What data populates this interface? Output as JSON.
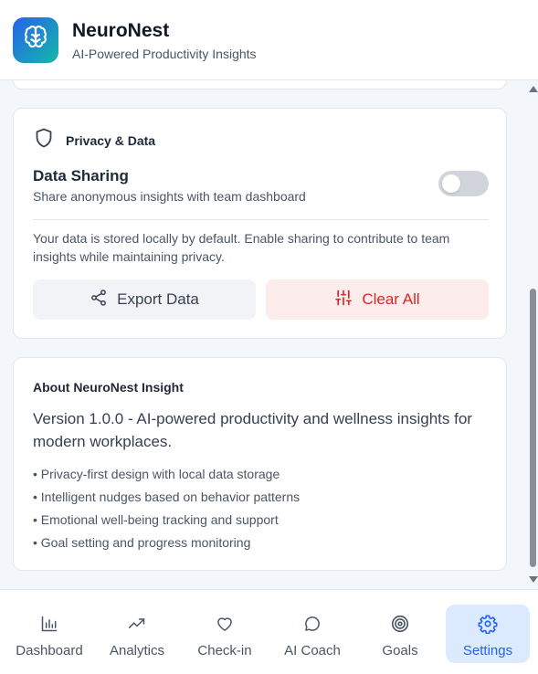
{
  "app": {
    "title": "NeuroNest",
    "subtitle": "AI-Powered Productivity Insights",
    "logo_icon": "brain-icon",
    "gradient": [
      "#2563eb",
      "#14b8a6"
    ]
  },
  "privacy": {
    "heading": "Privacy & Data",
    "icon": "shield-icon",
    "data_sharing_title": "Data Sharing",
    "data_sharing_desc": "Share anonymous insights with team dashboard",
    "data_sharing_enabled": false,
    "note": "Your data is stored locally by default. Enable sharing to contribute to team insights while maintaining privacy.",
    "export_label": "Export Data",
    "export_icon": "share-icon",
    "clear_label": "Clear All",
    "clear_icon": "sliders-icon",
    "danger_color": "#dc2626"
  },
  "about": {
    "title": "About NeuroNest Insight",
    "description": "Version 1.0.0 - AI-powered productivity and wellness insights for modern workplaces.",
    "features": [
      "• Privacy-first design with local data storage",
      "• Intelligent nudges based on behavior patterns",
      "• Emotional well-being tracking and support",
      "• Goal setting and progress monitoring"
    ]
  },
  "nav": {
    "accent": "#2563eb",
    "active": "settings",
    "items": [
      {
        "label": "Dashboard",
        "icon": "bar-chart-icon"
      },
      {
        "label": "Analytics",
        "icon": "trending-up-icon"
      },
      {
        "label": "Check-in",
        "icon": "heart-icon"
      },
      {
        "label": "AI Coach",
        "icon": "chat-bubble-icon"
      },
      {
        "label": "Goals",
        "icon": "target-icon"
      },
      {
        "label": "Settings",
        "icon": "gear-icon"
      }
    ]
  }
}
